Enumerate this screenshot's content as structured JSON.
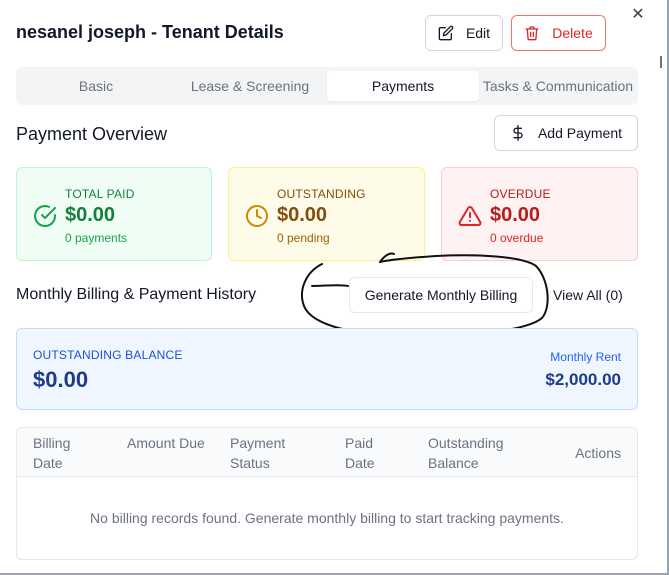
{
  "header": {
    "title": "nesanel joseph - Tenant Details",
    "edit_label": "Edit",
    "delete_label": "Delete",
    "close_glyph": "✕"
  },
  "tabs": [
    {
      "label": "Basic",
      "active": false
    },
    {
      "label": "Lease & Screening",
      "active": false
    },
    {
      "label": "Payments",
      "active": true
    },
    {
      "label": "Tasks & Communication",
      "active": false
    }
  ],
  "overview": {
    "title": "Payment Overview",
    "add_label": "Add Payment",
    "cards": [
      {
        "label": "TOTAL PAID",
        "amount": "$0.00",
        "sub": "0 payments",
        "icon": "check-circle-icon",
        "color": "#15803d"
      },
      {
        "label": "OUTSTANDING",
        "amount": "$0.00",
        "sub": "0 pending",
        "icon": "clock-icon",
        "color": "#ca8a04"
      },
      {
        "label": "OVERDUE",
        "amount": "$0.00",
        "sub": "0 overdue",
        "icon": "alert-triangle-icon",
        "color": "#dc2626"
      }
    ]
  },
  "billing": {
    "title": "Monthly Billing & Payment History",
    "generate_label": "Generate Monthly Billing",
    "view_all_label": "View All (0)"
  },
  "balance": {
    "label": "OUTSTANDING BALANCE",
    "amount": "$0.00",
    "rent_label": "Monthly Rent",
    "rent_amount": "$2,000.00"
  },
  "table": {
    "columns": [
      "Billing Date",
      "Amount Due",
      "Payment Status",
      "Paid Date",
      "Outstanding Balance",
      "Actions"
    ],
    "empty_message": "No billing records found. Generate monthly billing to start tracking payments."
  }
}
